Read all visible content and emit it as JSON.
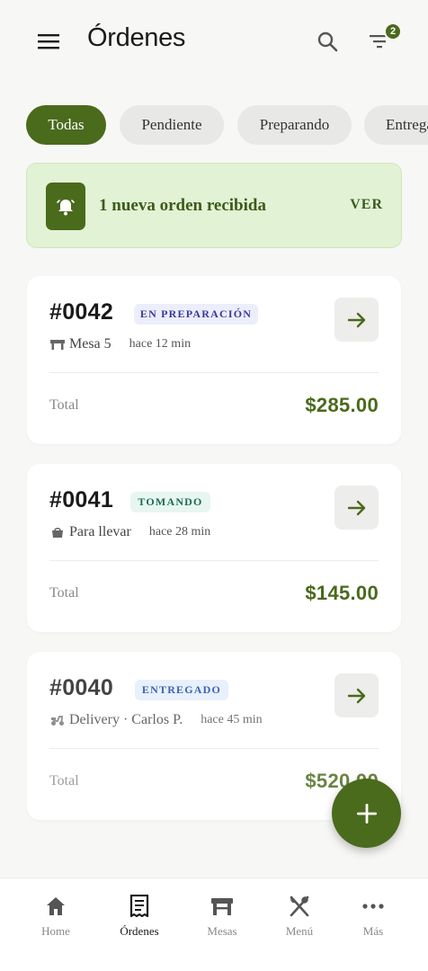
{
  "header": {
    "title": "Órdenes",
    "filter_badge": "2"
  },
  "chips": [
    {
      "label": "Todas",
      "active": true
    },
    {
      "label": "Pendiente",
      "active": false
    },
    {
      "label": "Preparando",
      "active": false
    },
    {
      "label": "Entregado",
      "active": false
    }
  ],
  "notice": {
    "text": "1 nueva orden recibida",
    "action": "VER"
  },
  "orders": [
    {
      "number": "#0042",
      "status": "EN PREPARACIÓN",
      "status_type": "prep",
      "icon": "table-icon",
      "place": "Mesa 5",
      "time": "hace 12 min",
      "total_label": "Total",
      "total": "$285.00"
    },
    {
      "number": "#0041",
      "status": "TOMANDO",
      "status_type": "taking",
      "icon": "takeaway-bag-icon",
      "place": "Para llevar",
      "time": "hace 28 min",
      "total_label": "Total",
      "total": "$145.00"
    },
    {
      "number": "#0040",
      "status": "ENTREGADO",
      "status_type": "delivered",
      "icon": "scooter-icon",
      "place": "Delivery · Carlos P.",
      "time": "hace 45 min",
      "total_label": "Total",
      "total": "$520.00"
    }
  ],
  "nav": [
    {
      "label": "Home",
      "icon": "home-icon",
      "active": false
    },
    {
      "label": "Órdenes",
      "icon": "receipt-icon",
      "active": true
    },
    {
      "label": "Mesas",
      "icon": "table-icon",
      "active": false
    },
    {
      "label": "Menú",
      "icon": "utensils-icon",
      "active": false
    },
    {
      "label": "Más",
      "icon": "more-icon",
      "active": false
    }
  ],
  "colors": {
    "primary": "#4a6a1c",
    "notice_bg": "#e2f2d5",
    "background": "#f7f7f5"
  }
}
